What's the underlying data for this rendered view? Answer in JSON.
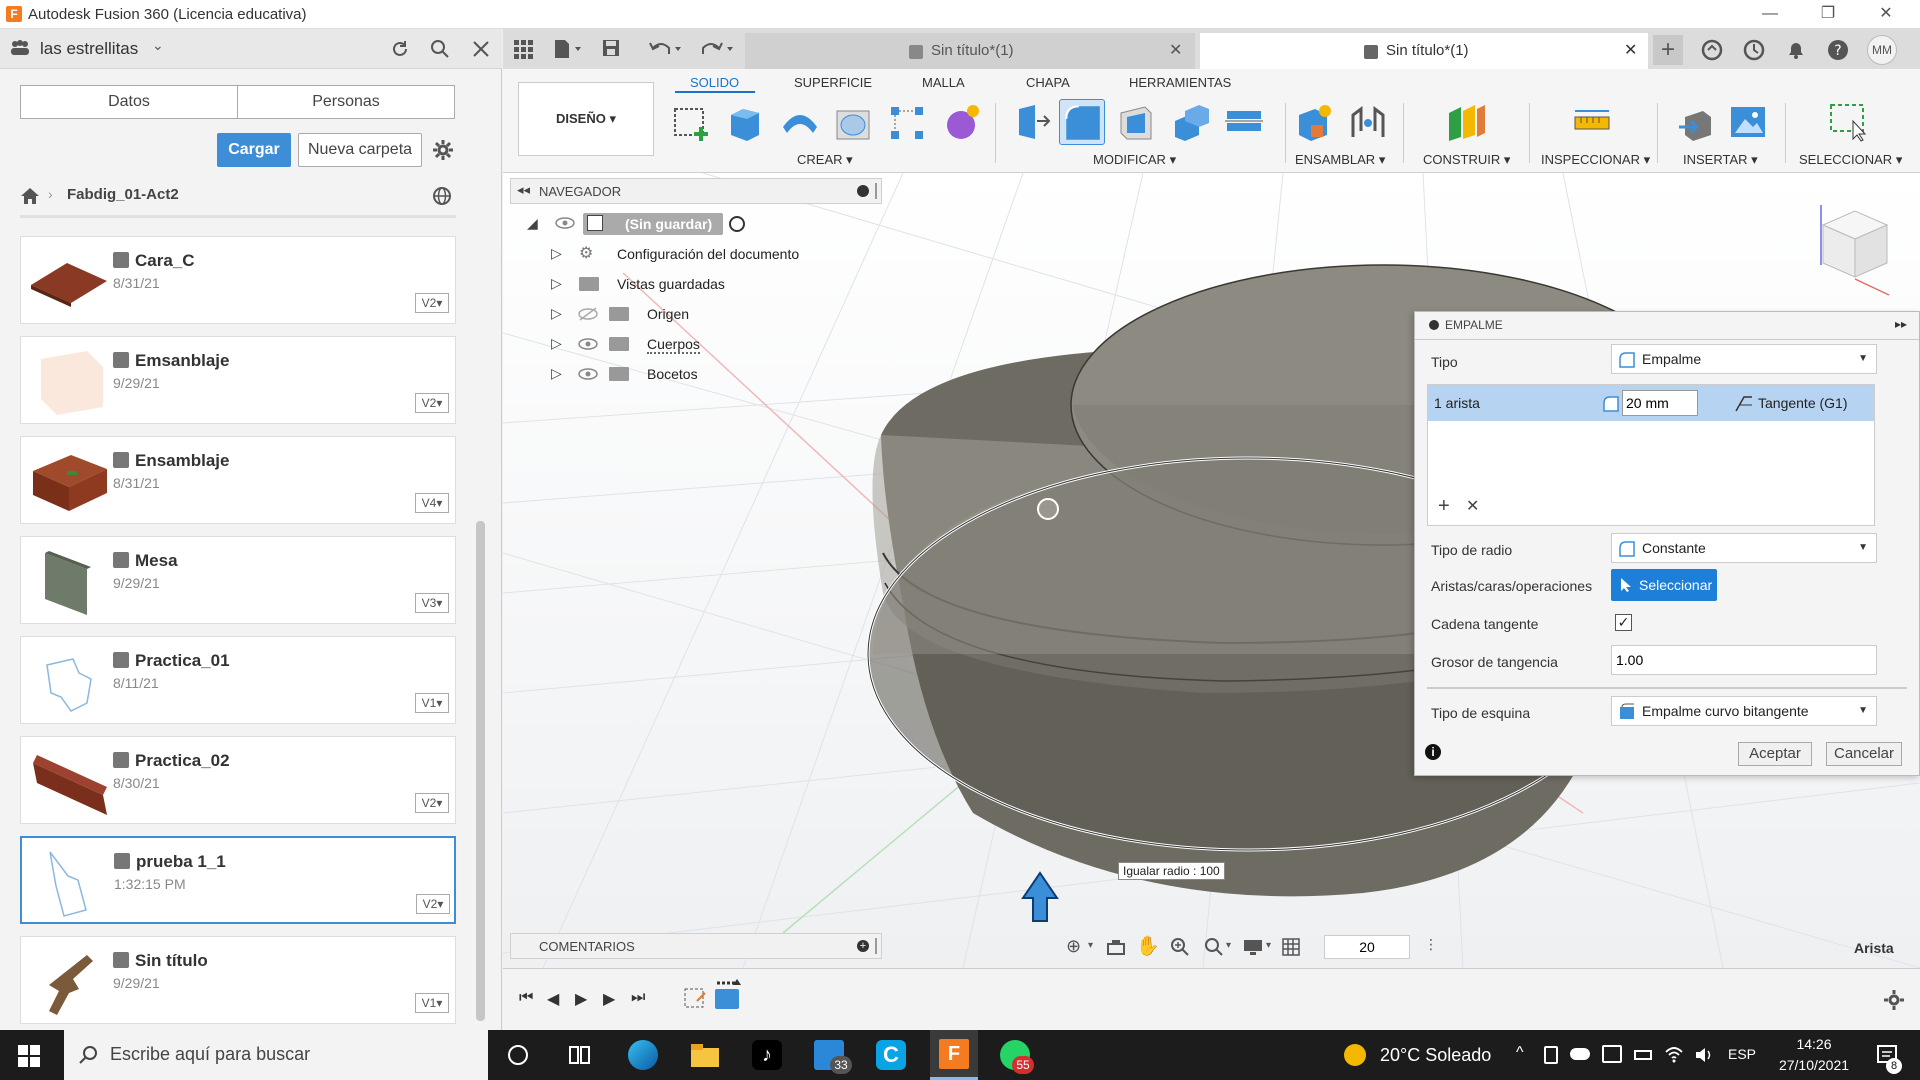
{
  "window": {
    "title": "Autodesk Fusion 360 (Licencia educativa)",
    "logo_letter": "F"
  },
  "data_panel": {
    "team": "las estrellitas",
    "tabs": [
      "Datos",
      "Personas"
    ],
    "upload_label": "Cargar",
    "new_folder_label": "Nueva carpeta",
    "breadcrumb": "Fabdig_01-Act2",
    "files": [
      {
        "name": "Cara_C",
        "date": "8/31/21",
        "version": "V2"
      },
      {
        "name": "Emsanblaje",
        "date": "9/29/21",
        "version": "V2"
      },
      {
        "name": "Ensamblaje",
        "date": "8/31/21",
        "version": "V4"
      },
      {
        "name": "Mesa",
        "date": "9/29/21",
        "version": "V3"
      },
      {
        "name": "Practica_01",
        "date": "8/11/21",
        "version": "V1"
      },
      {
        "name": "Practica_02",
        "date": "8/30/21",
        "version": "V2"
      },
      {
        "name": "prueba 1_1",
        "date": "1:32:15 PM",
        "version": "V2"
      },
      {
        "name": "Sin título",
        "date": "9/29/21",
        "version": "V1"
      }
    ]
  },
  "tabs": [
    {
      "label": "Sin título*(1)"
    },
    {
      "label": "Sin título*(1)"
    }
  ],
  "user_initials": "MM",
  "toolbar": {
    "workspace": "DISEÑO",
    "ribbon_tabs": [
      "SOLIDO",
      "SUPERFICIE",
      "MALLA",
      "CHAPA",
      "HERRAMIENTAS"
    ],
    "groups": [
      "CREAR",
      "MODIFICAR",
      "ENSAMBLAR",
      "CONSTRUIR",
      "INSPECCIONAR",
      "INSERTAR",
      "SELECCIONAR"
    ]
  },
  "navigator": {
    "title": "NAVEGADOR",
    "root": "(Sin guardar)",
    "items": [
      "Configuración del documento",
      "Vistas guardadas",
      "Origen",
      "Cuerpos",
      "Bocetos"
    ]
  },
  "dialog": {
    "title": "EMPALME",
    "tipo_label": "Tipo",
    "tipo_value": "Empalme",
    "edge_count": "1 arista",
    "radius": "20 mm",
    "continuity": "Tangente (G1)",
    "tipo_radio_label": "Tipo de radio",
    "tipo_radio_value": "Constante",
    "aristas_label": "Aristas/caras/operaciones",
    "select_label": "Seleccionar",
    "cadena_label": "Cadena tangente",
    "grosor_label": "Grosor de tangencia",
    "grosor_value": "1.00",
    "esquina_label": "Tipo de esquina",
    "esquina_value": "Empalme curvo bitangente",
    "accept_label": "Aceptar",
    "cancel_label": "Cancelar"
  },
  "viewport": {
    "tooltip": "Igualar radio : 100",
    "radius_input": "20",
    "selection_type": "Arista"
  },
  "comments": {
    "title": "COMENTARIOS"
  },
  "taskbar": {
    "search_placeholder": "Escribe aquí para buscar",
    "badge_33": "33",
    "badge_55": "55",
    "weather": "20°C  Soleado",
    "lang": "ESP",
    "time": "14:26",
    "date": "27/10/2021",
    "notifications": "8"
  },
  "colors": {
    "accent": "#1a73c9",
    "button_blue": "#3d8ed6",
    "body_gray": "#7d7a70"
  }
}
